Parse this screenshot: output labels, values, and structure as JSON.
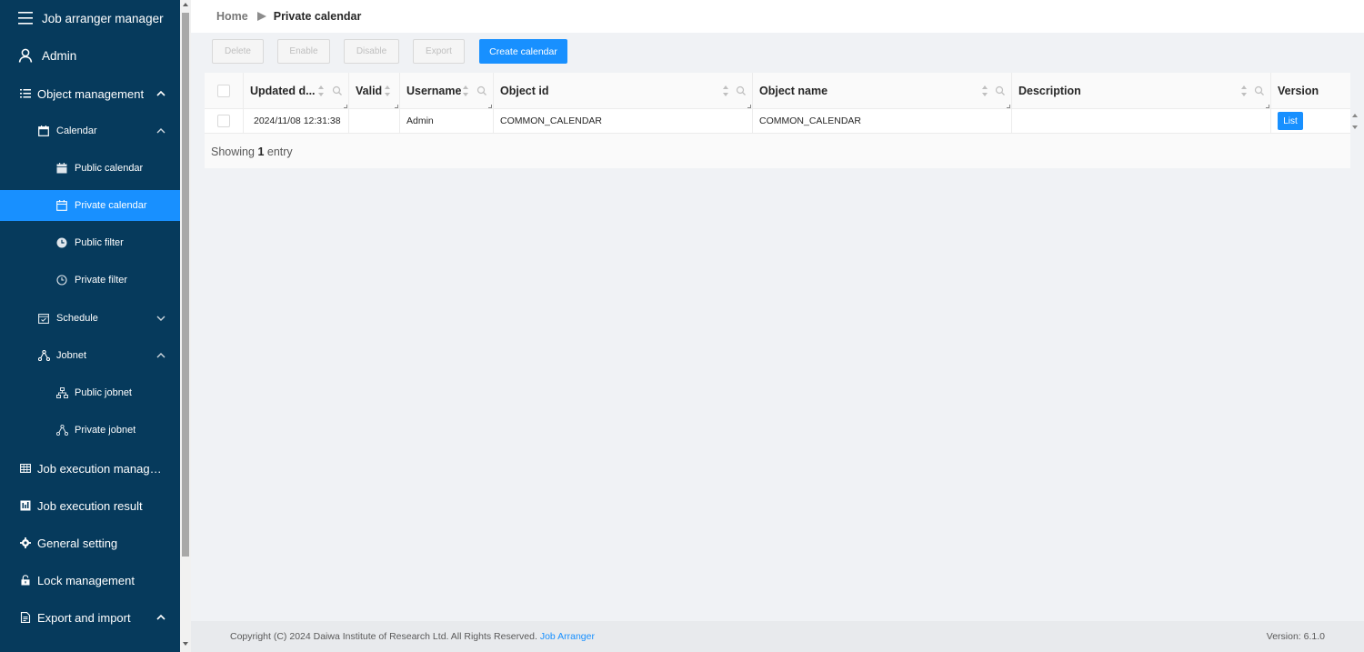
{
  "app": {
    "title": "Job arranger manager"
  },
  "user": {
    "name": "Admin"
  },
  "sidebar": {
    "object_management": "Object management",
    "calendar": "Calendar",
    "public_calendar": "Public calendar",
    "private_calendar": "Private calendar",
    "public_filter": "Public filter",
    "private_filter": "Private filter",
    "schedule": "Schedule",
    "jobnet": "Jobnet",
    "public_jobnet": "Public jobnet",
    "private_jobnet": "Private jobnet",
    "job_execution_management": "Job execution managem...",
    "job_execution_result": "Job execution result",
    "general_setting": "General setting",
    "lock_management": "Lock management",
    "export_and_import": "Export and import"
  },
  "breadcrumb": {
    "home": "Home",
    "current": "Private calendar"
  },
  "toolbar": {
    "delete": "Delete",
    "enable": "Enable",
    "disable": "Disable",
    "export": "Export",
    "create": "Create calendar"
  },
  "table": {
    "columns": [
      "Updated d...",
      "Valid",
      "Username",
      "Object id",
      "Object name",
      "Description",
      "Version"
    ],
    "rows": [
      {
        "updated": "2024/11/08 12:31:38",
        "valid": "",
        "username": "Admin",
        "object_id": "COMMON_CALENDAR",
        "object_name": "COMMON_CALENDAR",
        "description": "",
        "version_button": "List"
      }
    ],
    "showing_prefix": "Showing",
    "showing_count": "1",
    "showing_suffix": "entry"
  },
  "footer": {
    "copyright": "Copyright (C) 2024 Daiwa Institute of Research Ltd. All Rights Reserved.",
    "link": "Job Arranger",
    "version": "Version: 6.1.0"
  },
  "colors": {
    "sidebar": "#063a5c",
    "accent": "#1890ff"
  }
}
